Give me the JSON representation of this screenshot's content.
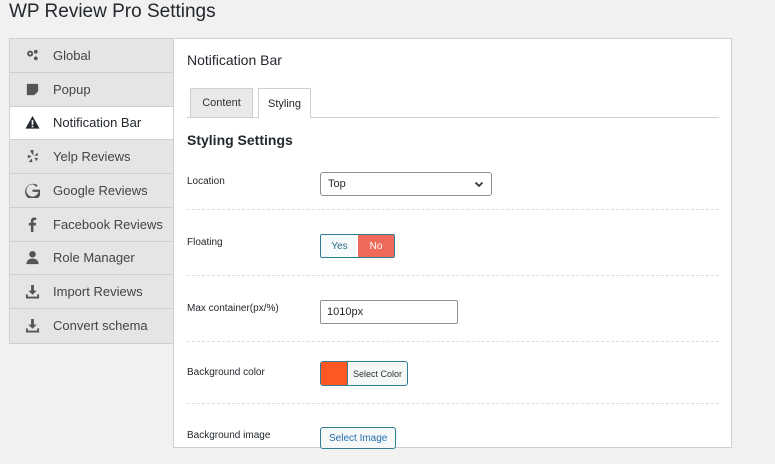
{
  "page": {
    "title": "WP Review Pro Settings"
  },
  "sidebar": {
    "items": [
      {
        "label": "Global",
        "icon": "gears-icon"
      },
      {
        "label": "Popup",
        "icon": "popup-icon"
      },
      {
        "label": "Notification Bar",
        "icon": "warning-icon",
        "active": true
      },
      {
        "label": "Yelp Reviews",
        "icon": "yelp-icon"
      },
      {
        "label": "Google Reviews",
        "icon": "google-icon"
      },
      {
        "label": "Facebook Reviews",
        "icon": "facebook-icon"
      },
      {
        "label": "Role Manager",
        "icon": "user-icon"
      },
      {
        "label": "Import Reviews",
        "icon": "download-icon"
      },
      {
        "label": "Convert schema",
        "icon": "download-icon"
      }
    ]
  },
  "panel": {
    "title": "Notification Bar",
    "tabs": [
      {
        "label": "Content",
        "active": false
      },
      {
        "label": "Styling",
        "active": true
      }
    ],
    "section_title": "Styling Settings",
    "fields": {
      "location": {
        "label": "Location",
        "value": "Top"
      },
      "floating": {
        "label": "Floating",
        "yes": "Yes",
        "no": "No",
        "selected": "No"
      },
      "max_container": {
        "label": "Max container(px/%)",
        "value": "1010px"
      },
      "background_color": {
        "label": "Background color",
        "button": "Select Color",
        "color": "#fe5722"
      },
      "background_image": {
        "label": "Background image",
        "button": "Select Image"
      }
    }
  },
  "colors": {
    "accent": "#2e7f94",
    "no_active": "#f06a5c",
    "swatch": "#fe5722"
  }
}
